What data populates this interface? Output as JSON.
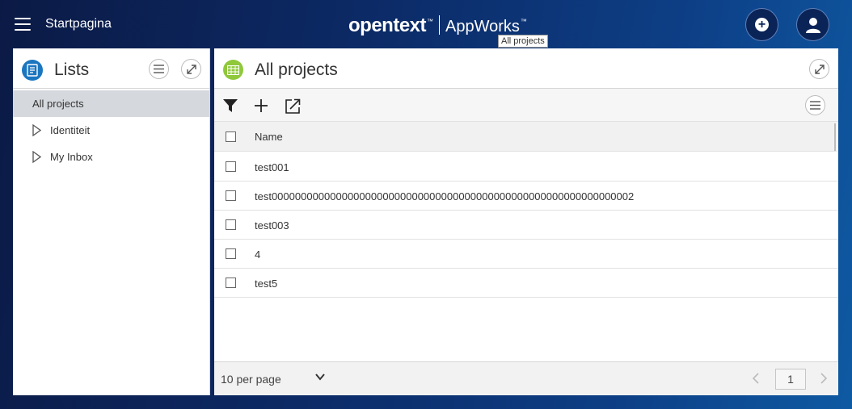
{
  "header": {
    "home_label": "Startpagina",
    "brand_name": "opentext",
    "brand_product": "AppWorks",
    "brand_tm": "™",
    "tooltip": "All projects",
    "accent_color": "#0b2457"
  },
  "left_panel": {
    "title": "Lists",
    "items": [
      {
        "label": "All projects",
        "selected": true,
        "expandable": false
      },
      {
        "label": "Identiteit",
        "selected": false,
        "expandable": true
      },
      {
        "label": "My Inbox",
        "selected": false,
        "expandable": true
      }
    ]
  },
  "main_panel": {
    "title": "All projects",
    "table": {
      "columns": [
        "Name"
      ],
      "rows": [
        {
          "name": "test001"
        },
        {
          "name": "test00000000000000000000000000000000000000000000000000000000000002"
        },
        {
          "name": "test003"
        },
        {
          "name": "4"
        },
        {
          "name": "test5"
        }
      ]
    },
    "footer": {
      "per_page": "10 per page",
      "current_page": "1"
    }
  }
}
